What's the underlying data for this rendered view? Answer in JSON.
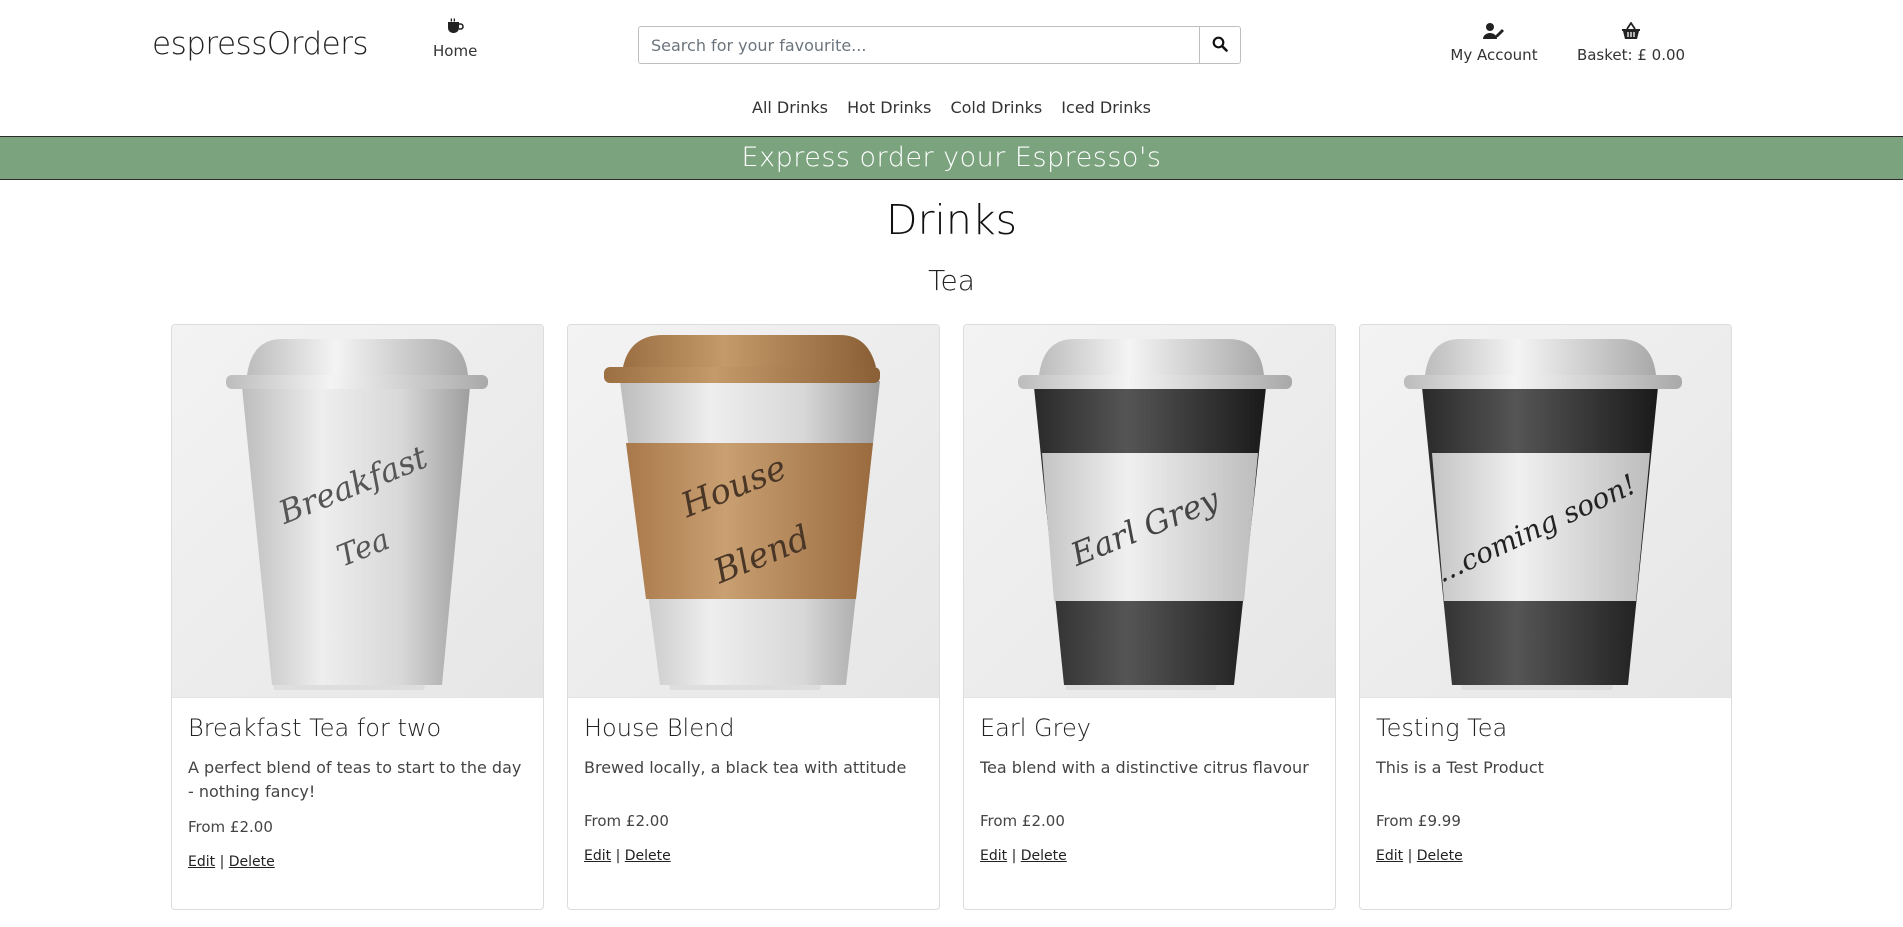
{
  "brand": {
    "logo": "espressOrders"
  },
  "nav": {
    "home_label": "Home",
    "account_label": "My Account",
    "basket_label": "Basket: £ 0.00"
  },
  "search": {
    "placeholder": "Search for your favourite..."
  },
  "categories": [
    "All Drinks",
    "Hot Drinks",
    "Cold Drinks",
    "Iced Drinks"
  ],
  "banner": {
    "text": "Express order your Espresso's"
  },
  "page": {
    "title": "Drinks",
    "section": "Tea"
  },
  "products": [
    {
      "name": "Breakfast Tea for two",
      "description": "A perfect blend of teas to start to the day - nothing fancy!",
      "price": "From £2.00",
      "cup_label": [
        "Breakfast",
        "Tea"
      ],
      "cup_style": "white",
      "edit_label": "Edit",
      "delete_label": "Delete"
    },
    {
      "name": "House Blend",
      "description": "Brewed locally, a black tea with attitude",
      "price": "From £2.00",
      "cup_label": [
        "House",
        "Blend"
      ],
      "cup_style": "brown",
      "edit_label": "Edit",
      "delete_label": "Delete"
    },
    {
      "name": "Earl Grey",
      "description": "Tea blend with a distinctive citrus flavour",
      "price": "From £2.00",
      "cup_label": [
        "Earl Grey"
      ],
      "cup_style": "black",
      "edit_label": "Edit",
      "delete_label": "Delete"
    },
    {
      "name": "Testing Tea",
      "description": "This is a Test Product",
      "price": "From £9.99",
      "cup_label": [
        "...coming soon!"
      ],
      "cup_style": "black",
      "edit_label": "Edit",
      "delete_label": "Delete"
    }
  ],
  "colors": {
    "banner": "#7aa37e",
    "brown_sleeve": "#c09466",
    "black_cup": "#2f2f2f"
  },
  "icons": {
    "home": "coffee-cup-icon",
    "search": "search-icon",
    "account": "user-edit-icon",
    "basket": "basket-icon"
  }
}
